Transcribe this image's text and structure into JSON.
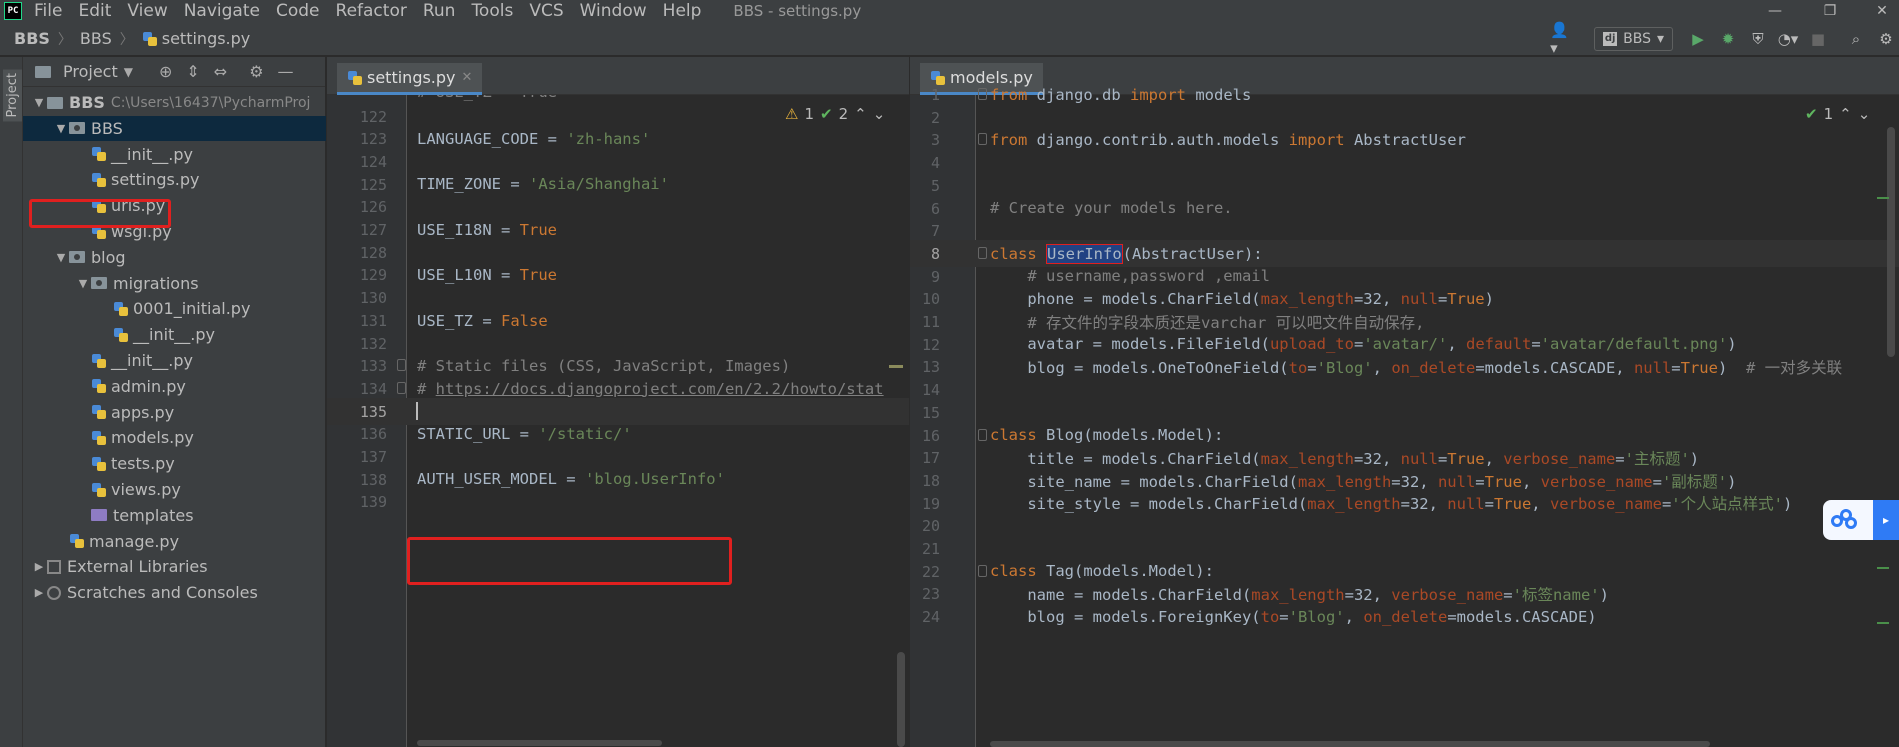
{
  "menubar": {
    "logo": "PC",
    "items": [
      "File",
      "Edit",
      "View",
      "Navigate",
      "Code",
      "Refactor",
      "Run",
      "Tools",
      "VCS",
      "Window",
      "Help"
    ],
    "title": "BBS - settings.py"
  },
  "navbar": {
    "crumbs": [
      "BBS",
      "BBS",
      "settings.py"
    ],
    "run_config": "BBS"
  },
  "left_strip": {
    "label": "Project"
  },
  "project_panel": {
    "title": "Project",
    "tree": [
      {
        "label": "BBS",
        "suffix": "C:\\Users\\16437\\PycharmProj",
        "icon": "folder",
        "depth": 0,
        "arrow": "▼"
      },
      {
        "label": "BBS",
        "icon": "package-folder",
        "depth": 1,
        "arrow": "▼",
        "selected": true
      },
      {
        "label": "__init__.py",
        "icon": "python-file",
        "depth": 2
      },
      {
        "label": "settings.py",
        "icon": "python-file",
        "depth": 2
      },
      {
        "label": "urls.py",
        "icon": "python-file",
        "depth": 2
      },
      {
        "label": "wsgi.py",
        "icon": "python-file",
        "depth": 2
      },
      {
        "label": "blog",
        "icon": "package-folder",
        "depth": 1,
        "arrow": "▼"
      },
      {
        "label": "migrations",
        "icon": "package-folder",
        "depth": 2,
        "arrow": "▼"
      },
      {
        "label": "0001_initial.py",
        "icon": "python-file",
        "depth": 3
      },
      {
        "label": "__init__.py",
        "icon": "python-file",
        "depth": 3
      },
      {
        "label": "__init__.py",
        "icon": "python-file",
        "depth": 2
      },
      {
        "label": "admin.py",
        "icon": "python-file",
        "depth": 2
      },
      {
        "label": "apps.py",
        "icon": "python-file",
        "depth": 2
      },
      {
        "label": "models.py",
        "icon": "python-file",
        "depth": 2
      },
      {
        "label": "tests.py",
        "icon": "python-file",
        "depth": 2
      },
      {
        "label": "views.py",
        "icon": "python-file",
        "depth": 2
      },
      {
        "label": "templates",
        "icon": "templates-folder",
        "depth": 2
      },
      {
        "label": "manage.py",
        "icon": "python-file",
        "depth": 1
      },
      {
        "label": "External Libraries",
        "icon": "library",
        "depth": 0,
        "arrow": "▶"
      },
      {
        "label": "Scratches and Consoles",
        "icon": "scratches",
        "depth": 0,
        "arrow": "▶"
      }
    ]
  },
  "left_editor": {
    "tab": "settings.py",
    "inspections": {
      "warnings": "1",
      "weak_warnings": "2"
    },
    "current_line": "135",
    "lines": [
      {
        "n": "122",
        "tokens": []
      },
      {
        "n": "123",
        "tokens": [
          [
            "id",
            "LANGUAGE_CODE = "
          ],
          [
            "str",
            "'zh-hans'"
          ]
        ]
      },
      {
        "n": "124",
        "tokens": []
      },
      {
        "n": "125",
        "tokens": [
          [
            "id",
            "TIME_ZONE = "
          ],
          [
            "str",
            "'Asia/Shanghai'"
          ]
        ]
      },
      {
        "n": "126",
        "tokens": []
      },
      {
        "n": "127",
        "tokens": [
          [
            "id",
            "USE_I18N = "
          ],
          [
            "kw",
            "True"
          ]
        ]
      },
      {
        "n": "128",
        "tokens": []
      },
      {
        "n": "129",
        "tokens": [
          [
            "id",
            "USE_L10N = "
          ],
          [
            "kw",
            "True"
          ]
        ]
      },
      {
        "n": "130",
        "tokens": []
      },
      {
        "n": "131",
        "tokens": [
          [
            "id",
            "USE_TZ = "
          ],
          [
            "kw",
            "False"
          ]
        ]
      },
      {
        "n": "132",
        "tokens": []
      },
      {
        "n": "133",
        "tokens": [
          [
            "cmt",
            "# Static files (CSS, JavaScript, Images)"
          ]
        ]
      },
      {
        "n": "134",
        "tokens": [
          [
            "cmt",
            "# "
          ],
          [
            "link",
            "https://docs.djangoproject.com/en/2.2/howto/stat"
          ]
        ]
      },
      {
        "n": "135",
        "tokens": []
      },
      {
        "n": "136",
        "tokens": [
          [
            "id",
            "STATIC_URL = "
          ],
          [
            "str",
            "'/static/'"
          ]
        ]
      },
      {
        "n": "137",
        "tokens": []
      },
      {
        "n": "138",
        "tokens": [
          [
            "id",
            "AUTH_USER_MODEL = "
          ],
          [
            "str",
            "'blog.UserInfo'"
          ]
        ]
      },
      {
        "n": "139",
        "tokens": []
      }
    ],
    "top_partial": "# USE_TZ = True"
  },
  "right_editor": {
    "tab": "models.py",
    "inspections": {
      "weak_warnings": "1"
    },
    "current_line": "8",
    "lines": [
      {
        "n": "1",
        "tokens": [
          [
            "kw",
            "from "
          ],
          [
            "id",
            "django.db "
          ],
          [
            "kw",
            "import "
          ],
          [
            "id",
            "models"
          ]
        ]
      },
      {
        "n": "2",
        "tokens": []
      },
      {
        "n": "3",
        "tokens": [
          [
            "kw",
            "from "
          ],
          [
            "id",
            "django.contrib.auth.models "
          ],
          [
            "kw",
            "import "
          ],
          [
            "id",
            "AbstractUser"
          ]
        ]
      },
      {
        "n": "4",
        "tokens": []
      },
      {
        "n": "5",
        "tokens": []
      },
      {
        "n": "6",
        "tokens": [
          [
            "cmt",
            "# Create your models here."
          ]
        ]
      },
      {
        "n": "7",
        "tokens": []
      },
      {
        "n": "8",
        "tokens": [
          [
            "kw",
            "class "
          ],
          [
            "hl",
            "UserInfo"
          ],
          [
            "id",
            "(AbstractUser):"
          ]
        ]
      },
      {
        "n": "9",
        "tokens": [
          [
            "id",
            "    "
          ],
          [
            "cmt",
            "# username,password ,email"
          ]
        ]
      },
      {
        "n": "10",
        "tokens": [
          [
            "id",
            "    phone = models.CharField("
          ],
          [
            "param",
            "max_length"
          ],
          [
            "id",
            "=32, "
          ],
          [
            "param",
            "null"
          ],
          [
            "id",
            "="
          ],
          [
            "kw",
            "True"
          ],
          [
            "id",
            ")"
          ]
        ]
      },
      {
        "n": "11",
        "tokens": [
          [
            "id",
            "    "
          ],
          [
            "cmt",
            "# 存文件的字段本质还是varchar 可以吧文件自动保存,"
          ]
        ]
      },
      {
        "n": "12",
        "tokens": [
          [
            "id",
            "    avatar = models.FileField("
          ],
          [
            "param",
            "upload_to"
          ],
          [
            "id",
            "="
          ],
          [
            "str",
            "'avatar/'"
          ],
          [
            "id",
            ", "
          ],
          [
            "param",
            "default"
          ],
          [
            "id",
            "="
          ],
          [
            "str",
            "'avatar/default.png'"
          ],
          [
            "id",
            ")"
          ]
        ]
      },
      {
        "n": "13",
        "tokens": [
          [
            "id",
            "    blog = models.OneToOneField("
          ],
          [
            "param",
            "to"
          ],
          [
            "id",
            "="
          ],
          [
            "str",
            "'Blog'"
          ],
          [
            "id",
            ", "
          ],
          [
            "param",
            "on_delete"
          ],
          [
            "id",
            "=models.CASCADE, "
          ],
          [
            "param",
            "null"
          ],
          [
            "id",
            "="
          ],
          [
            "kw",
            "True"
          ],
          [
            "id",
            ")  "
          ],
          [
            "cmt",
            "# 一对多关联"
          ]
        ]
      },
      {
        "n": "14",
        "tokens": []
      },
      {
        "n": "15",
        "tokens": []
      },
      {
        "n": "16",
        "tokens": [
          [
            "kw",
            "class "
          ],
          [
            "id",
            "Blog(models.Model):"
          ]
        ]
      },
      {
        "n": "17",
        "tokens": [
          [
            "id",
            "    title = models.CharField("
          ],
          [
            "param",
            "max_length"
          ],
          [
            "id",
            "=32, "
          ],
          [
            "param",
            "null"
          ],
          [
            "id",
            "="
          ],
          [
            "kw",
            "True"
          ],
          [
            "id",
            ", "
          ],
          [
            "param",
            "verbose_name"
          ],
          [
            "id",
            "="
          ],
          [
            "str",
            "'主标题'"
          ],
          [
            "id",
            ")"
          ]
        ]
      },
      {
        "n": "18",
        "tokens": [
          [
            "id",
            "    site_name = models.CharField("
          ],
          [
            "param",
            "max_length"
          ],
          [
            "id",
            "=32, "
          ],
          [
            "param",
            "null"
          ],
          [
            "id",
            "="
          ],
          [
            "kw",
            "True"
          ],
          [
            "id",
            ", "
          ],
          [
            "param",
            "verbose_name"
          ],
          [
            "id",
            "="
          ],
          [
            "str",
            "'副标题'"
          ],
          [
            "id",
            ")"
          ]
        ]
      },
      {
        "n": "19",
        "tokens": [
          [
            "id",
            "    site_style = models.CharField("
          ],
          [
            "param",
            "max_length"
          ],
          [
            "id",
            "=32, "
          ],
          [
            "param",
            "null"
          ],
          [
            "id",
            "="
          ],
          [
            "kw",
            "True"
          ],
          [
            "id",
            ", "
          ],
          [
            "param",
            "verbose_name"
          ],
          [
            "id",
            "="
          ],
          [
            "str",
            "'个人站点样式'"
          ],
          [
            "id",
            ")"
          ]
        ]
      },
      {
        "n": "20",
        "tokens": []
      },
      {
        "n": "21",
        "tokens": []
      },
      {
        "n": "22",
        "tokens": [
          [
            "kw",
            "class "
          ],
          [
            "id",
            "Tag(models.Model):"
          ]
        ]
      },
      {
        "n": "23",
        "tokens": [
          [
            "id",
            "    name = models.CharField("
          ],
          [
            "param",
            "max_length"
          ],
          [
            "id",
            "=32, "
          ],
          [
            "param",
            "verbose_name"
          ],
          [
            "id",
            "="
          ],
          [
            "str",
            "'标签name'"
          ],
          [
            "id",
            ")"
          ]
        ]
      },
      {
        "n": "24",
        "tokens": [
          [
            "id",
            "    blog = models.ForeignKey("
          ],
          [
            "param",
            "to"
          ],
          [
            "id",
            "="
          ],
          [
            "str",
            "'Blog'"
          ],
          [
            "id",
            ", "
          ],
          [
            "param",
            "on_delete"
          ],
          [
            "id",
            "=models.CASCADE)"
          ]
        ]
      }
    ]
  },
  "colors": {
    "keyword": "#cc7832",
    "string": "#6a8759",
    "comment": "#808080",
    "param": "#aa4926",
    "annotation_box": "#e0201f"
  }
}
